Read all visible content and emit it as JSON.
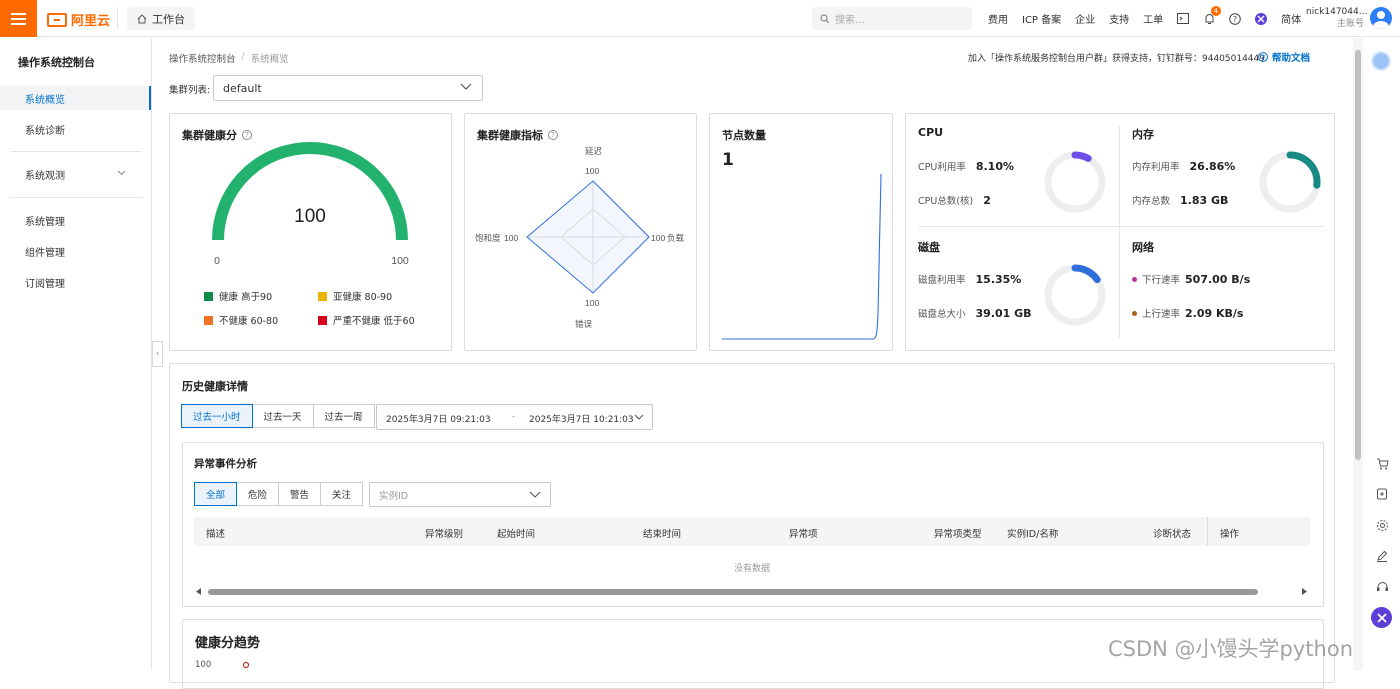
{
  "topbar": {
    "logo_text": "阿里云",
    "workbench_label": "工作台",
    "search_placeholder": "搜索...",
    "nav": [
      "费用",
      "ICP 备案",
      "企业",
      "支持",
      "工单"
    ],
    "notification_count": "4",
    "language": "简体",
    "user_name": "nick147044...",
    "user_role": "主账号"
  },
  "sidebar": {
    "title": "操作系统控制台",
    "items": [
      "系统概览",
      "系统诊断",
      "系统观测",
      "系统管理",
      "组件管理",
      "订阅管理"
    ]
  },
  "breadcrumb": [
    "操作系统控制台",
    "系统概览"
  ],
  "notice": "加入「操作系统服务控制台用户群」获得支持，钉钉群号：94405014449",
  "help_link": "帮助文档",
  "cluster": {
    "label": "集群列表:",
    "value": "default"
  },
  "health_score": {
    "title": "集群健康分",
    "value": 100,
    "min_label": "0",
    "max_label": "100",
    "color": "#23b26d",
    "legend": [
      {
        "label": "健康 高于90",
        "color": "#0f8a4f"
      },
      {
        "label": "亚健康 80-90",
        "color": "#e8b40c"
      },
      {
        "label": "不健康 60-80",
        "color": "#f27224"
      },
      {
        "label": "严重不健康 低于60",
        "color": "#d9001b"
      }
    ]
  },
  "health_indicators": {
    "title": "集群健康指标",
    "axes": [
      {
        "name": "饱和度",
        "value": "100"
      },
      {
        "name": "延迟",
        "value": "100"
      },
      {
        "name": "负载",
        "value": "100"
      },
      {
        "name": "错误",
        "value": "100"
      }
    ]
  },
  "node_count": {
    "title": "节点数量",
    "value": "1"
  },
  "metrics": {
    "cpu": {
      "title": "CPU",
      "usage_label": "CPU利用率",
      "usage": "8.10%",
      "usage_fraction": 0.081,
      "total_label": "CPU总数(核)",
      "total": "2",
      "color": "#6b4fe8"
    },
    "memory": {
      "title": "内存",
      "usage_label": "内存利用率",
      "usage": "26.86%",
      "usage_fraction": 0.2686,
      "total_label": "内存总数",
      "total": "1.83 GB",
      "color": "#178a84"
    },
    "disk": {
      "title": "磁盘",
      "usage_label": "磁盘利用率",
      "usage": "15.35%",
      "usage_fraction": 0.1535,
      "total_label": "磁盘总大小",
      "total": "39.01 GB",
      "color": "#2f6fdb"
    },
    "network": {
      "title": "网络",
      "down_label": "下行速率",
      "down": "507.00 B/s",
      "down_color": "#b8329a",
      "up_label": "上行速率",
      "up": "2.09 KB/s",
      "up_color": "#a8621f"
    }
  },
  "history": {
    "title": "历史健康详情",
    "ranges": [
      "过去一小时",
      "过去一天",
      "过去一周"
    ],
    "start": "2025年3月7日 09:21:03",
    "sep": "-",
    "end": "2025年3月7日 10:21:03"
  },
  "anomaly": {
    "title": "异常事件分析",
    "filters": [
      "全部",
      "危险",
      "警告",
      "关注"
    ],
    "instance_placeholder": "实例ID",
    "columns": [
      "描述",
      "异常级别",
      "起始时间",
      "结束时间",
      "异常项",
      "异常项类型",
      "实例ID/名称",
      "诊断状态",
      "操作"
    ],
    "empty": "没有数据"
  },
  "trend": {
    "title": "健康分趋势",
    "y_top": "100"
  },
  "watermark": "CSDN @小馒头学python"
}
